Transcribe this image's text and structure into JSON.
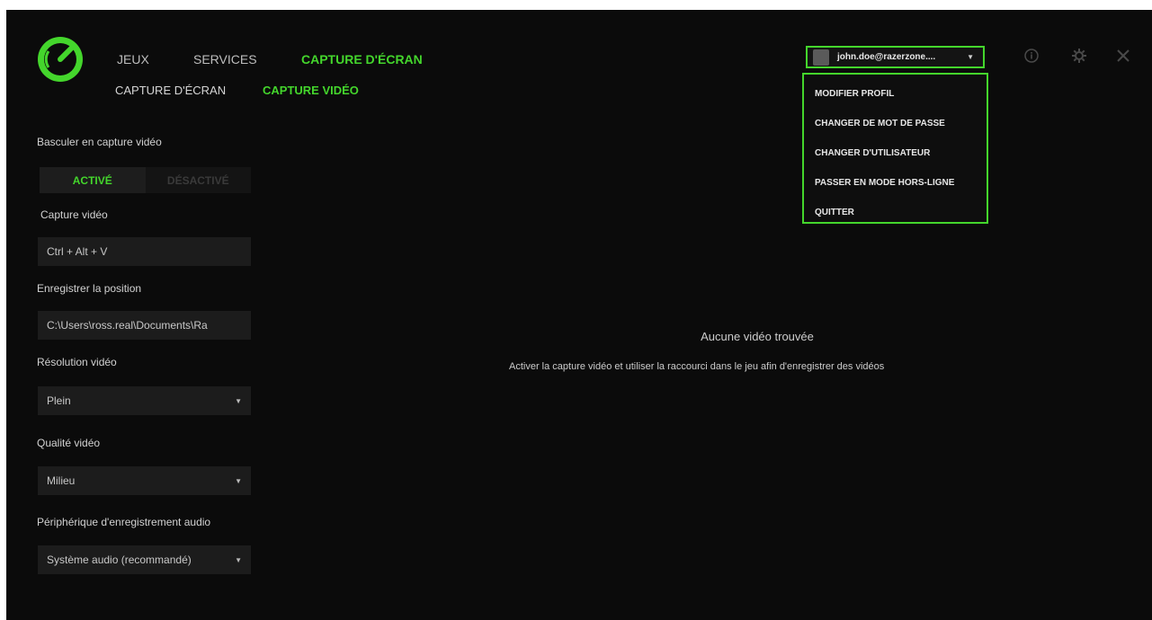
{
  "nav": {
    "top": [
      "JEUX",
      "SERVICES",
      "CAPTURE D'ÉCRAN"
    ],
    "sub": [
      "CAPTURE D'ÉCRAN",
      "CAPTURE VIDÉO"
    ]
  },
  "account": {
    "username": "john.doe@razerzone....",
    "menu": [
      "MODIFIER PROFIL",
      "CHANGER DE MOT DE PASSE",
      "CHANGER D'UTILISATEUR",
      "PASSER EN MODE HORS-LIGNE",
      "QUITTER"
    ]
  },
  "settings": {
    "toggle_label": "Basculer en capture vidéo",
    "toggle_on": "ACTIVÉ",
    "toggle_off": "DÉSACTIVÉ",
    "hotkey_label": "Capture vidéo",
    "hotkey_value": "Ctrl + Alt + V",
    "location_label": "Enregistrer la position",
    "location_value": "C:\\Users\\ross.real\\Documents\\Ra",
    "resolution_label": "Résolution vidéo",
    "resolution_value": "Plein",
    "quality_label": "Qualité vidéo",
    "quality_value": "Milieu",
    "audio_label": "Périphérique d'enregistrement audio",
    "audio_value": "Système audio (recommandé)"
  },
  "empty_state": {
    "title": "Aucune vidéo trouvée",
    "description": "Activer la capture vidéo et utiliser la raccourci dans le jeu afin d'enregistrer des vidéos"
  },
  "colors": {
    "accent": "#44d62c",
    "background": "#0b0b0b",
    "field": "#1c1c1c"
  },
  "icons": [
    "razer-cortex-logo",
    "info-icon",
    "gear-icon",
    "close-icon",
    "chevron-down-icon"
  ]
}
